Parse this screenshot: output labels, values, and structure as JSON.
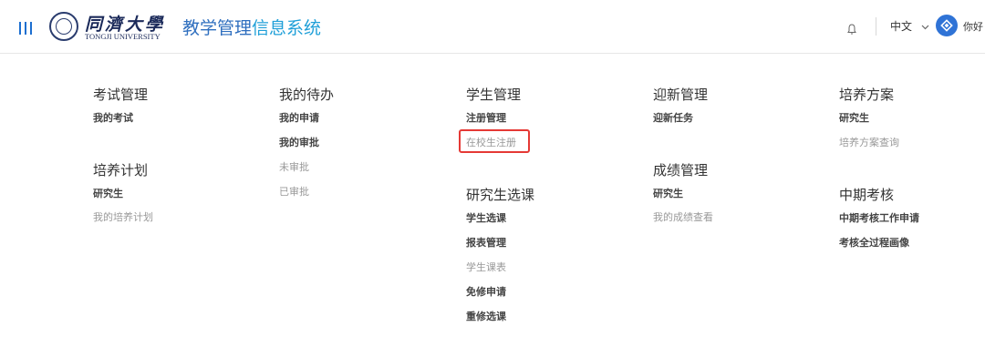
{
  "header": {
    "university_cn": "同濟大學",
    "university_en": "TONGJI UNIVERSITY",
    "system_title_part1": "教学管理",
    "system_title_part2": "信息系统",
    "language": "中文",
    "greeting": "你好",
    "accent_color": "#1d6fd0"
  },
  "menu": {
    "exam": {
      "title": "考试管理",
      "items": [
        "我的考试"
      ]
    },
    "plan": {
      "title": "培养计划",
      "items": [
        "研究生",
        "我的培养计划"
      ]
    },
    "todo": {
      "title": "我的待办",
      "items": [
        "我的申请",
        "我的审批",
        "未审批",
        "已审批"
      ]
    },
    "student": {
      "title": "学生管理",
      "items": [
        "注册管理",
        "在校生注册"
      ]
    },
    "course": {
      "title": "研究生选课",
      "items": [
        "学生选课",
        "报表管理",
        "学生课表",
        "免修申请",
        "重修选课"
      ]
    },
    "welcome": {
      "title": "迎新管理",
      "items": [
        "迎新任务"
      ]
    },
    "grade": {
      "title": "成绩管理",
      "items": [
        "研究生",
        "我的成绩查看"
      ]
    },
    "scheme": {
      "title": "培养方案",
      "items": [
        "研究生",
        "培养方案查询"
      ]
    },
    "midterm": {
      "title": "中期考核",
      "items": [
        "中期考核工作申请",
        "考核全过程画像"
      ]
    }
  }
}
